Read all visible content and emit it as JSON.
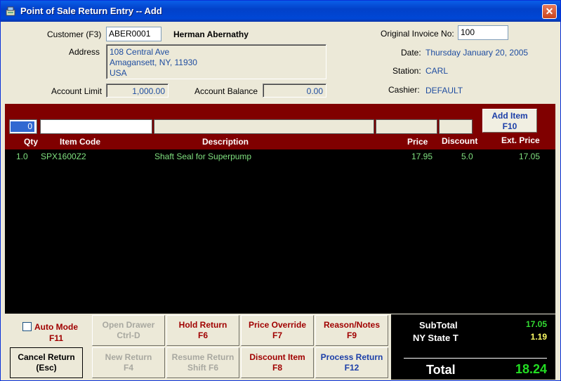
{
  "window": {
    "title": "Point of Sale Return Entry -- Add",
    "close_label": "✕"
  },
  "customer": {
    "label": "Customer (F3)",
    "code": "ABER0001",
    "name": "Herman Abernathy",
    "address_label": "Address",
    "address_lines": [
      "108 Central Ave",
      "Amagansett, NY, 11930",
      "USA"
    ],
    "account_limit_label": "Account Limit",
    "account_limit": "1,000.00",
    "account_balance_label": "Account Balance",
    "account_balance": "0.00"
  },
  "invoice": {
    "original_invoice_label": "Original Invoice No:",
    "original_invoice_value": "100",
    "date_label": "Date:",
    "date_value": "Thursday January 20, 2005",
    "station_label": "Station:",
    "station_value": "CARL",
    "cashier_label": "Cashier:",
    "cashier_value": "DEFAULT"
  },
  "entry": {
    "qty_value": "0",
    "add_item_label": "Add Item",
    "add_item_key": "F10"
  },
  "columns": {
    "qty": "Qty",
    "item_code": "Item Code",
    "description": "Description",
    "price": "Price",
    "discount": "Discount",
    "ext_price": "Ext. Price"
  },
  "items": [
    {
      "qty": "1.0",
      "item_code": "SPX1600Z2",
      "description": "Shaft Seal for Superpump",
      "price": "17.95",
      "discount": "5.0",
      "ext_price": "17.05"
    }
  ],
  "buttons": {
    "auto_mode": {
      "label": "Auto Mode",
      "key": "F11"
    },
    "open_drawer": {
      "label": "Open Drawer",
      "key": "Ctrl-D"
    },
    "hold_return": {
      "label": "Hold Return",
      "key": "F6"
    },
    "price_override": {
      "label": "Price Override",
      "key": "F7"
    },
    "reason_notes": {
      "label": "Reason/Notes",
      "key": "F9"
    },
    "cancel_return": {
      "label": "Cancel Return",
      "key": "(Esc)"
    },
    "new_return": {
      "label": "New Return",
      "key": "F4"
    },
    "resume_return": {
      "label": "Resume Return",
      "key": "Shift  F6"
    },
    "discount_item": {
      "label": "Discount Item",
      "key": "F8"
    },
    "process_return": {
      "label": "Process Return",
      "key": "F12"
    }
  },
  "totals": {
    "subtotal_label": "SubTotal",
    "subtotal": "17.05",
    "tax_label": "NY State T",
    "tax": "1.19",
    "total_label": "Total",
    "total": "18.24"
  },
  "colors": {
    "panel_red": "#800000",
    "grid_text": "#7fe07f",
    "subtotal_green": "#33dd33",
    "tax_yellow": "#ffff66",
    "total_green": "#22dd22"
  }
}
